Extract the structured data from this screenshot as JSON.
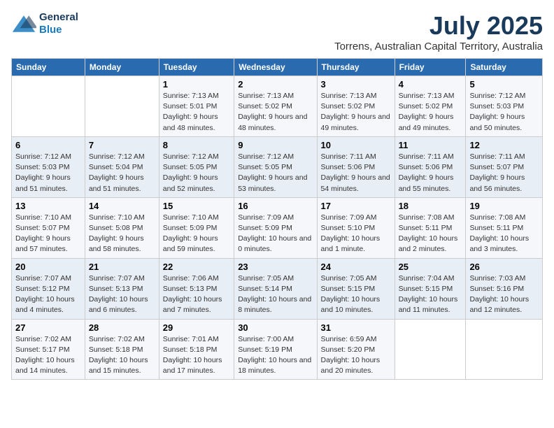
{
  "header": {
    "logo_line1": "General",
    "logo_line2": "Blue",
    "month": "July 2025",
    "location": "Torrens, Australian Capital Territory, Australia"
  },
  "days_of_week": [
    "Sunday",
    "Monday",
    "Tuesday",
    "Wednesday",
    "Thursday",
    "Friday",
    "Saturday"
  ],
  "weeks": [
    [
      {
        "day": "",
        "text": ""
      },
      {
        "day": "",
        "text": ""
      },
      {
        "day": "1",
        "text": "Sunrise: 7:13 AM\nSunset: 5:01 PM\nDaylight: 9 hours and 48 minutes."
      },
      {
        "day": "2",
        "text": "Sunrise: 7:13 AM\nSunset: 5:02 PM\nDaylight: 9 hours and 48 minutes."
      },
      {
        "day": "3",
        "text": "Sunrise: 7:13 AM\nSunset: 5:02 PM\nDaylight: 9 hours and 49 minutes."
      },
      {
        "day": "4",
        "text": "Sunrise: 7:13 AM\nSunset: 5:02 PM\nDaylight: 9 hours and 49 minutes."
      },
      {
        "day": "5",
        "text": "Sunrise: 7:12 AM\nSunset: 5:03 PM\nDaylight: 9 hours and 50 minutes."
      }
    ],
    [
      {
        "day": "6",
        "text": "Sunrise: 7:12 AM\nSunset: 5:03 PM\nDaylight: 9 hours and 51 minutes."
      },
      {
        "day": "7",
        "text": "Sunrise: 7:12 AM\nSunset: 5:04 PM\nDaylight: 9 hours and 51 minutes."
      },
      {
        "day": "8",
        "text": "Sunrise: 7:12 AM\nSunset: 5:05 PM\nDaylight: 9 hours and 52 minutes."
      },
      {
        "day": "9",
        "text": "Sunrise: 7:12 AM\nSunset: 5:05 PM\nDaylight: 9 hours and 53 minutes."
      },
      {
        "day": "10",
        "text": "Sunrise: 7:11 AM\nSunset: 5:06 PM\nDaylight: 9 hours and 54 minutes."
      },
      {
        "day": "11",
        "text": "Sunrise: 7:11 AM\nSunset: 5:06 PM\nDaylight: 9 hours and 55 minutes."
      },
      {
        "day": "12",
        "text": "Sunrise: 7:11 AM\nSunset: 5:07 PM\nDaylight: 9 hours and 56 minutes."
      }
    ],
    [
      {
        "day": "13",
        "text": "Sunrise: 7:10 AM\nSunset: 5:07 PM\nDaylight: 9 hours and 57 minutes."
      },
      {
        "day": "14",
        "text": "Sunrise: 7:10 AM\nSunset: 5:08 PM\nDaylight: 9 hours and 58 minutes."
      },
      {
        "day": "15",
        "text": "Sunrise: 7:10 AM\nSunset: 5:09 PM\nDaylight: 9 hours and 59 minutes."
      },
      {
        "day": "16",
        "text": "Sunrise: 7:09 AM\nSunset: 5:09 PM\nDaylight: 10 hours and 0 minutes."
      },
      {
        "day": "17",
        "text": "Sunrise: 7:09 AM\nSunset: 5:10 PM\nDaylight: 10 hours and 1 minute."
      },
      {
        "day": "18",
        "text": "Sunrise: 7:08 AM\nSunset: 5:11 PM\nDaylight: 10 hours and 2 minutes."
      },
      {
        "day": "19",
        "text": "Sunrise: 7:08 AM\nSunset: 5:11 PM\nDaylight: 10 hours and 3 minutes."
      }
    ],
    [
      {
        "day": "20",
        "text": "Sunrise: 7:07 AM\nSunset: 5:12 PM\nDaylight: 10 hours and 4 minutes."
      },
      {
        "day": "21",
        "text": "Sunrise: 7:07 AM\nSunset: 5:13 PM\nDaylight: 10 hours and 6 minutes."
      },
      {
        "day": "22",
        "text": "Sunrise: 7:06 AM\nSunset: 5:13 PM\nDaylight: 10 hours and 7 minutes."
      },
      {
        "day": "23",
        "text": "Sunrise: 7:05 AM\nSunset: 5:14 PM\nDaylight: 10 hours and 8 minutes."
      },
      {
        "day": "24",
        "text": "Sunrise: 7:05 AM\nSunset: 5:15 PM\nDaylight: 10 hours and 10 minutes."
      },
      {
        "day": "25",
        "text": "Sunrise: 7:04 AM\nSunset: 5:15 PM\nDaylight: 10 hours and 11 minutes."
      },
      {
        "day": "26",
        "text": "Sunrise: 7:03 AM\nSunset: 5:16 PM\nDaylight: 10 hours and 12 minutes."
      }
    ],
    [
      {
        "day": "27",
        "text": "Sunrise: 7:02 AM\nSunset: 5:17 PM\nDaylight: 10 hours and 14 minutes."
      },
      {
        "day": "28",
        "text": "Sunrise: 7:02 AM\nSunset: 5:18 PM\nDaylight: 10 hours and 15 minutes."
      },
      {
        "day": "29",
        "text": "Sunrise: 7:01 AM\nSunset: 5:18 PM\nDaylight: 10 hours and 17 minutes."
      },
      {
        "day": "30",
        "text": "Sunrise: 7:00 AM\nSunset: 5:19 PM\nDaylight: 10 hours and 18 minutes."
      },
      {
        "day": "31",
        "text": "Sunrise: 6:59 AM\nSunset: 5:20 PM\nDaylight: 10 hours and 20 minutes."
      },
      {
        "day": "",
        "text": ""
      },
      {
        "day": "",
        "text": ""
      }
    ]
  ]
}
